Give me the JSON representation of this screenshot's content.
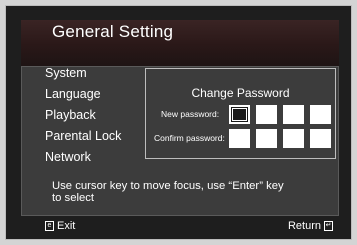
{
  "header": {
    "title": "General Setting"
  },
  "menu": {
    "items": [
      {
        "label": "System"
      },
      {
        "label": "Language"
      },
      {
        "label": "Playback"
      },
      {
        "label": "Parental Lock"
      },
      {
        "label": "Network"
      }
    ]
  },
  "password_dialog": {
    "title": "Change Password",
    "new_label": "New password:",
    "confirm_label": "Confirm password:",
    "focused_field": "new password, digit 1"
  },
  "hint": {
    "line1": "Use cursor key to move focus, use “Enter” key",
    "line2": "to select"
  },
  "footer": {
    "exit_label": "Exit",
    "exit_icon": "exit-key-icon",
    "exit_key_glyph": "e",
    "return_label": "Return",
    "return_icon": "return-key-icon",
    "return_key_glyph": "↵"
  },
  "colors": {
    "background": "#1e1e1e",
    "panel": "#3c3c3c",
    "title_bar": "#2a1818",
    "text": "#ffffff",
    "input": "#ffffff"
  }
}
